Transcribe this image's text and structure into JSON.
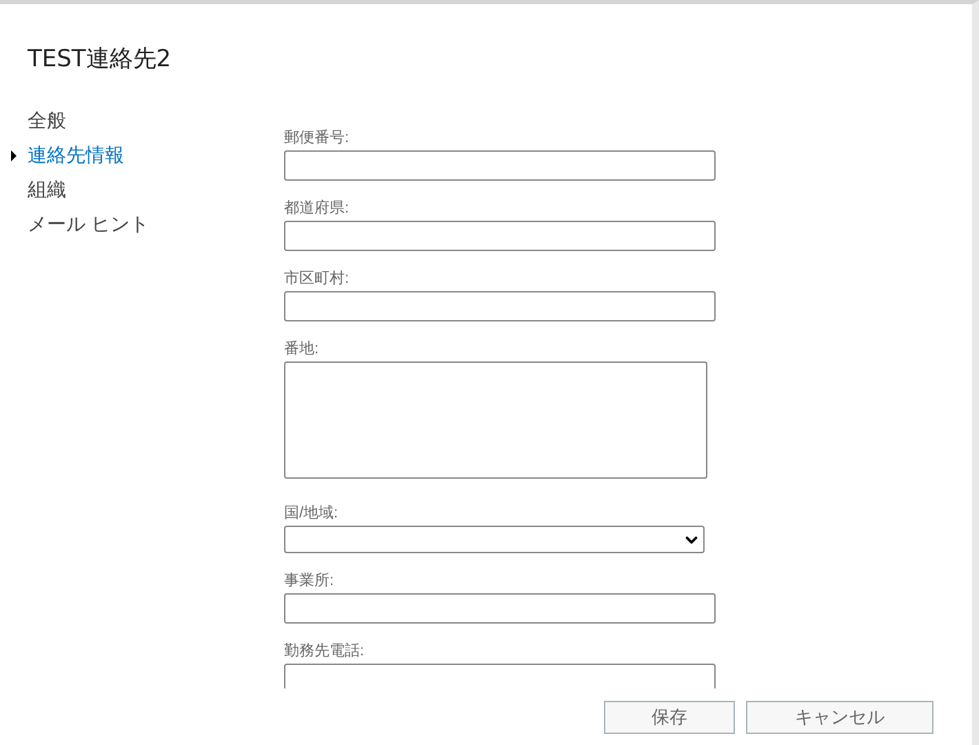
{
  "title": "TEST連絡先2",
  "nav": [
    {
      "label": "全般",
      "selected": false
    },
    {
      "label": "連絡先情報",
      "selected": true
    },
    {
      "label": "組織",
      "selected": false
    },
    {
      "label": "メール ヒント",
      "selected": false
    }
  ],
  "fields": [
    {
      "label": "郵便番号:",
      "kind": "input"
    },
    {
      "label": "都道府県:",
      "kind": "input"
    },
    {
      "label": "市区町村:",
      "kind": "input"
    },
    {
      "label": "番地:",
      "kind": "textarea"
    },
    {
      "label": "国/地域:",
      "kind": "select"
    },
    {
      "label": "事業所:",
      "kind": "input"
    },
    {
      "label": "勤務先電話:",
      "kind": "input"
    }
  ],
  "buttons": [
    "保存",
    "キャンセル"
  ]
}
